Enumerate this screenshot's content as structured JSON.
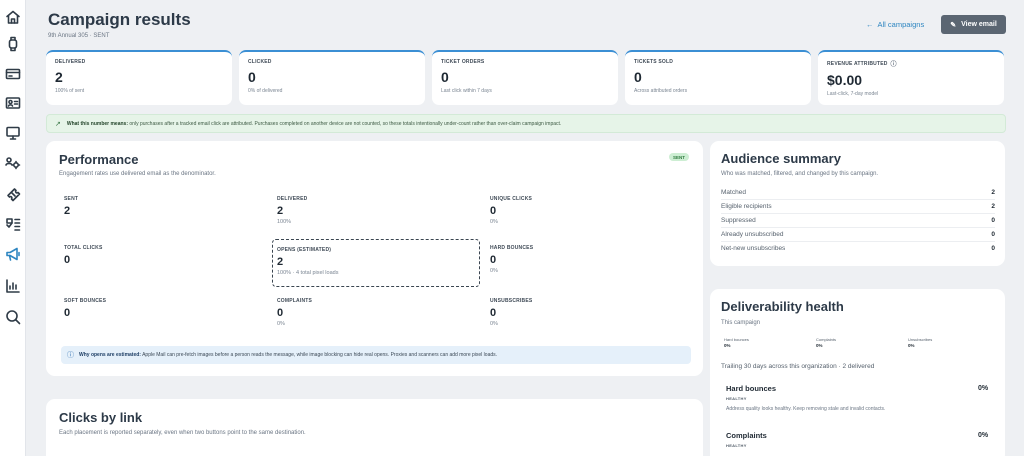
{
  "sidebar": {
    "items": [
      {
        "icon": "home-icon"
      },
      {
        "icon": "watch-icon"
      },
      {
        "icon": "card-icon"
      },
      {
        "icon": "contact-card-icon"
      },
      {
        "icon": "monitor-icon"
      },
      {
        "icon": "settings-group-icon"
      },
      {
        "icon": "ticket-icon"
      },
      {
        "icon": "list-icon"
      },
      {
        "icon": "megaphone-icon",
        "active": true
      },
      {
        "icon": "chart-icon"
      },
      {
        "icon": "search-chat-icon"
      }
    ]
  },
  "header": {
    "title": "Campaign results",
    "subtitle": "9th Annual 305 · SENT",
    "back_label": "All campaigns",
    "view_email_label": "View email"
  },
  "stats": [
    {
      "label": "DELIVERED",
      "value": "2",
      "note": "100% of sent"
    },
    {
      "label": "CLICKED",
      "value": "0",
      "note": "0% of delivered"
    },
    {
      "label": "TICKET ORDERS",
      "value": "0",
      "note": "Last click within 7 days"
    },
    {
      "label": "TICKETS SOLD",
      "value": "0",
      "note": "Across attributed orders"
    },
    {
      "label": "REVENUE ATTRIBUTED",
      "value": "$0.00",
      "note": "Last-click, 7-day model",
      "info": true
    }
  ],
  "banner": {
    "bold": "What this number means:",
    "text": "only purchases after a tracked email click are attributed. Purchases completed on another device are not counted, so these totals intentionally under-count rather than over-claim campaign impact."
  },
  "performance": {
    "title": "Performance",
    "subtitle": "Engagement rates use delivered email as the denominator.",
    "badge": "SENT",
    "metrics": [
      {
        "label": "SENT",
        "value": "2",
        "note": ""
      },
      {
        "label": "DELIVERED",
        "value": "2",
        "note": "100%"
      },
      {
        "label": "UNIQUE CLICKS",
        "value": "0",
        "note": "0%"
      },
      {
        "label": "TOTAL CLICKS",
        "value": "0",
        "note": ""
      },
      {
        "label": "OPENS (ESTIMATED)",
        "value": "2",
        "note": "100% · 4 total pixel loads"
      },
      {
        "label": "HARD BOUNCES",
        "value": "0",
        "note": "0%"
      },
      {
        "label": "SOFT BOUNCES",
        "value": "0",
        "note": ""
      },
      {
        "label": "COMPLAINTS",
        "value": "0",
        "note": "0%"
      },
      {
        "label": "UNSUBSCRIBES",
        "value": "0",
        "note": "0%"
      }
    ],
    "info_bold": "Why opens are estimated:",
    "info_text": "Apple Mail can pre-fetch images before a person reads the message, while image blocking can hide real opens. Proxies and scanners can add more pixel loads."
  },
  "audience": {
    "title": "Audience summary",
    "subtitle": "Who was matched, filtered, and changed by this campaign.",
    "rows": [
      {
        "label": "Matched",
        "value": "2"
      },
      {
        "label": "Eligible recipients",
        "value": "2"
      },
      {
        "label": "Suppressed",
        "value": "0"
      },
      {
        "label": "Already unsubscribed",
        "value": "0"
      },
      {
        "label": "Net-new unsubscribes",
        "value": "0"
      }
    ]
  },
  "deliverability": {
    "title": "Deliverability health",
    "subtitle": "This campaign",
    "mini": [
      {
        "label": "Hard bounces",
        "value": "0%"
      },
      {
        "label": "Complaints",
        "value": "0%"
      },
      {
        "label": "Unsubscribes",
        "value": "0%"
      }
    ],
    "trailing": "Trailing 30 days across this organization · 2 delivered",
    "items": [
      {
        "title": "Hard bounces",
        "value": "0%",
        "status": "HEALTHY",
        "desc": "Address quality looks healthy. Keep removing stale and invalid contacts."
      },
      {
        "title": "Complaints",
        "value": "0%",
        "status": "HEALTHY"
      }
    ]
  },
  "clicks": {
    "title": "Clicks by link",
    "subtitle": "Each placement is reported separately, even when two buttons point to the same destination."
  }
}
